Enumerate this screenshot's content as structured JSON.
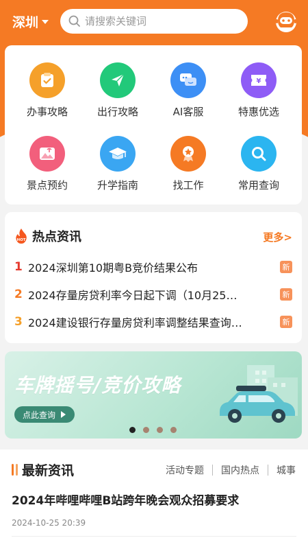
{
  "header": {
    "city": "深圳",
    "search_placeholder": "请搜索关键词"
  },
  "services": [
    {
      "label": "办事攻略",
      "icon": "clipboard-icon",
      "color": "#f5a02a"
    },
    {
      "label": "出行攻略",
      "icon": "send-icon",
      "color": "#22c97a"
    },
    {
      "label": "AI客服",
      "icon": "chat-icon",
      "color": "#3d8ff5"
    },
    {
      "label": "特惠优选",
      "icon": "coupon-icon",
      "color": "#8e5cf6"
    },
    {
      "label": "景点预约",
      "icon": "scenic-icon",
      "color": "#f25f7c"
    },
    {
      "label": "升学指南",
      "icon": "graduation-icon",
      "color": "#3aa6f2"
    },
    {
      "label": "找工作",
      "icon": "badge-icon",
      "color": "#f57a24"
    },
    {
      "label": "常用查询",
      "icon": "search-icon",
      "color": "#2bb5f0"
    }
  ],
  "hot_news": {
    "badge": "HOT",
    "title": "热点资讯",
    "more": "更多>",
    "items": [
      {
        "num": "1",
        "text": "2024深圳第10期粤B竞价结果公布",
        "tag": "新",
        "color": "#e53a2e"
      },
      {
        "num": "2",
        "text": "2024存量房贷利率今日起下调（10月25…",
        "tag": "新",
        "color": "#f57a24"
      },
      {
        "num": "3",
        "text": "2024建设银行存量房贷利率调整结果查询…",
        "tag": "新",
        "color": "#f5a02a"
      }
    ]
  },
  "banner": {
    "title": "车牌摇号/竞价攻略",
    "cta": "点此查询"
  },
  "latest": {
    "title": "最新资讯",
    "tabs": [
      "活动专题",
      "国内热点",
      "城事"
    ],
    "article_title": "2024年哔哩哔哩B站跨年晚会观众招募要求",
    "article_date": "2024-10-25 20:39"
  },
  "colors": {
    "brand": "#f57a24"
  }
}
